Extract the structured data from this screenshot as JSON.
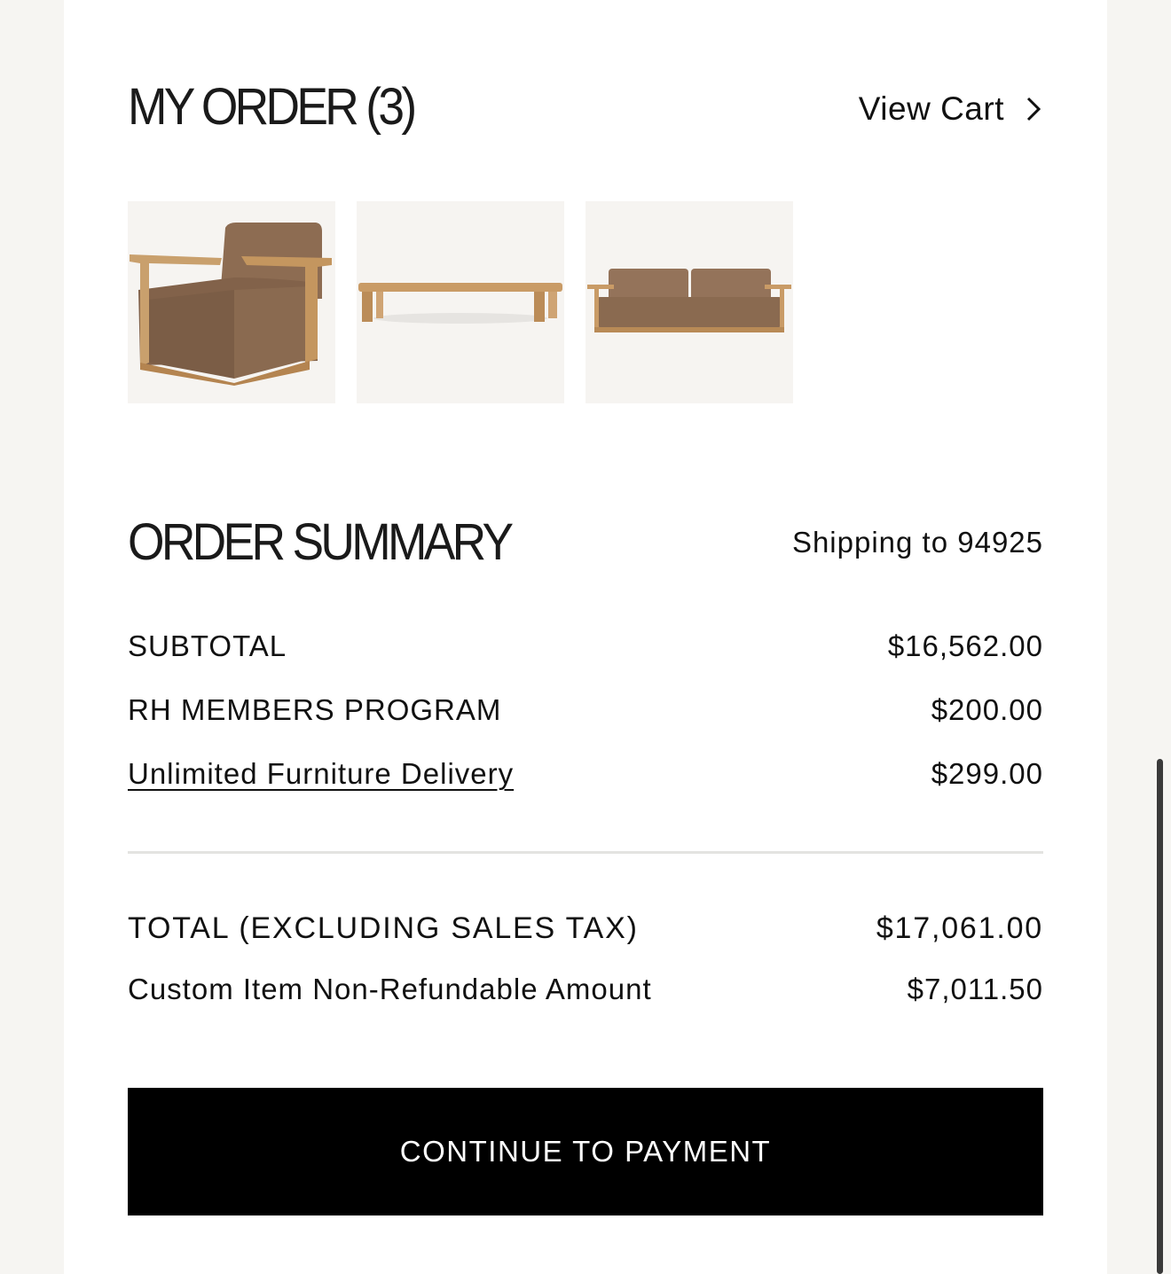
{
  "my_order": {
    "title": "MY ORDER (3)",
    "view_cart_label": "View Cart",
    "view_cart_icon": "chevron-right-icon",
    "items": [
      {
        "name": "Lounge chair",
        "icon": "lounge-chair-image"
      },
      {
        "name": "Coffee table",
        "icon": "coffee-table-image"
      },
      {
        "name": "Sofa",
        "icon": "sofa-image"
      }
    ]
  },
  "order_summary": {
    "title": "ORDER SUMMARY",
    "shipping_text": "Shipping to 94925",
    "lines": {
      "subtotal": {
        "label": "SUBTOTAL",
        "value": "$16,562.00"
      },
      "members": {
        "label": "RH MEMBERS PROGRAM",
        "value": "$200.00"
      },
      "delivery": {
        "label": "Unlimited Furniture Delivery",
        "value": "$299.00"
      }
    },
    "total": {
      "label": "TOTAL (EXCLUDING SALES TAX)",
      "value": "$17,061.00"
    },
    "non_refundable": {
      "label": "Custom Item Non-Refundable Amount",
      "value": "$7,011.50"
    }
  },
  "cta": {
    "label": "CONTINUE TO PAYMENT"
  },
  "colors": {
    "background": "#f6f5f2",
    "panel": "#ffffff",
    "button": "#000000",
    "upholstery": "#8b6b52",
    "wood": "#c99b66"
  }
}
